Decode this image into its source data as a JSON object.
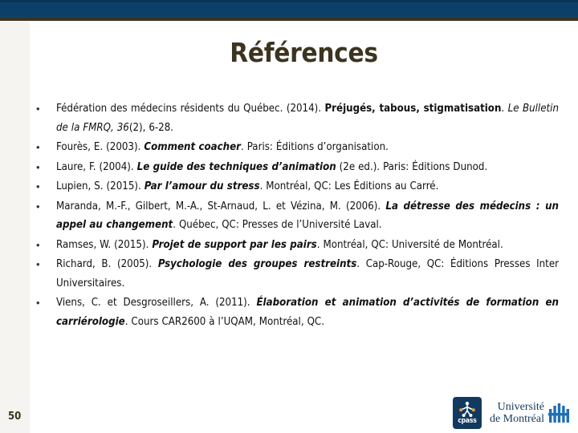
{
  "slide": {
    "title": "Références",
    "page_number": "50",
    "colors": {
      "header_navy": "#0d4068",
      "header_rule_olive": "#3b3420",
      "left_strip": "#f5f4f0",
      "title_text": "#3b3420",
      "body_text": "#111111",
      "logo_navy": "#123a60",
      "udem_blue": "#15395e"
    }
  },
  "references": [
    {
      "id": "ref-fmrq-2014",
      "html": "Fédération des médecins résidents du Québec. (2014). <b>Préjugés, tabous, stigmatisation</b>. <i>Le Bulletin de la FMRQ, 36</i>(2), 6-28.",
      "plain": "Fédération des médecins résidents du Québec. (2014). Préjugés, tabous, stigmatisation. Le Bulletin de la FMRQ, 36(2), 6-28."
    },
    {
      "id": "ref-foures-2003",
      "html": "Fourès, E. (2003). <span class=\"bi\">Comment coacher</span>. Paris: Éditions d’organisation.",
      "plain": "Fourès, E. (2003). Comment coacher. Paris: Éditions d’organisation."
    },
    {
      "id": "ref-laure-2004",
      "html": "Laure, F. (2004). <span class=\"bi\">Le guide des techniques d’animation</span> (2e ed.). Paris: Éditions Dunod.",
      "plain": "Laure, F. (2004). Le guide des techniques d’animation (2e ed.). Paris: Éditions Dunod."
    },
    {
      "id": "ref-lupien-2015",
      "html": "Lupien, S. (2015). <span class=\"bi\">Par l’amour du stress</span>. Montréal, QC: Les Éditions au Carré.",
      "plain": "Lupien, S. (2015). Par l’amour du stress. Montréal, QC: Les Éditions au Carré."
    },
    {
      "id": "ref-maranda-2006",
      "html": "Maranda, M.-F., Gilbert, M.-A., St-Arnaud, L. et Vézina, M. (2006). <span class=\"bi\">La détresse des médecins : un appel au changement</span>. Québec, QC: Presses de l’Université Laval.",
      "plain": "Maranda, M.-F., Gilbert, M.-A., St-Arnaud, L. et Vézina, M. (2006). La détresse des médecins : un appel au changement. Québec, QC: Presses de l’Université Laval."
    },
    {
      "id": "ref-ramses-2015",
      "html": "Ramses, W. (2015). <span class=\"bi\">Projet de support par les pairs</span>. Montréal, QC: Université de Montréal.",
      "plain": "Ramses, W. (2015). Projet de support par les pairs. Montréal, QC: Université de Montréal."
    },
    {
      "id": "ref-richard-2005",
      "html": "Richard, B. (2005). <span class=\"bi\">Psychologie des groupes restreints</span>. Cap-Rouge, QC: Éditions Presses Inter Universitaires.",
      "plain": "Richard, B. (2005). Psychologie des groupes restreints. Cap-Rouge, QC: Éditions Presses Inter Universitaires."
    },
    {
      "id": "ref-viens-2011",
      "html": "Viens, C. et Desgroseillers, A. (2011). <span class=\"bi\">Élaboration et animation d’activités de formation en carriérologie</span>. Cours CAR2600 à l’UQAM, Montréal, QC.",
      "plain": "Viens, C. et Desgroseillers, A. (2011). Élaboration et animation d’activités de formation en carriérologie. Cours CAR2600 à l’UQAM, Montréal, QC."
    }
  ],
  "footer": {
    "logos": {
      "cpass": {
        "wordmark": "cpass"
      },
      "udem": {
        "line1": "Université",
        "line2": "de Montréal"
      }
    }
  }
}
